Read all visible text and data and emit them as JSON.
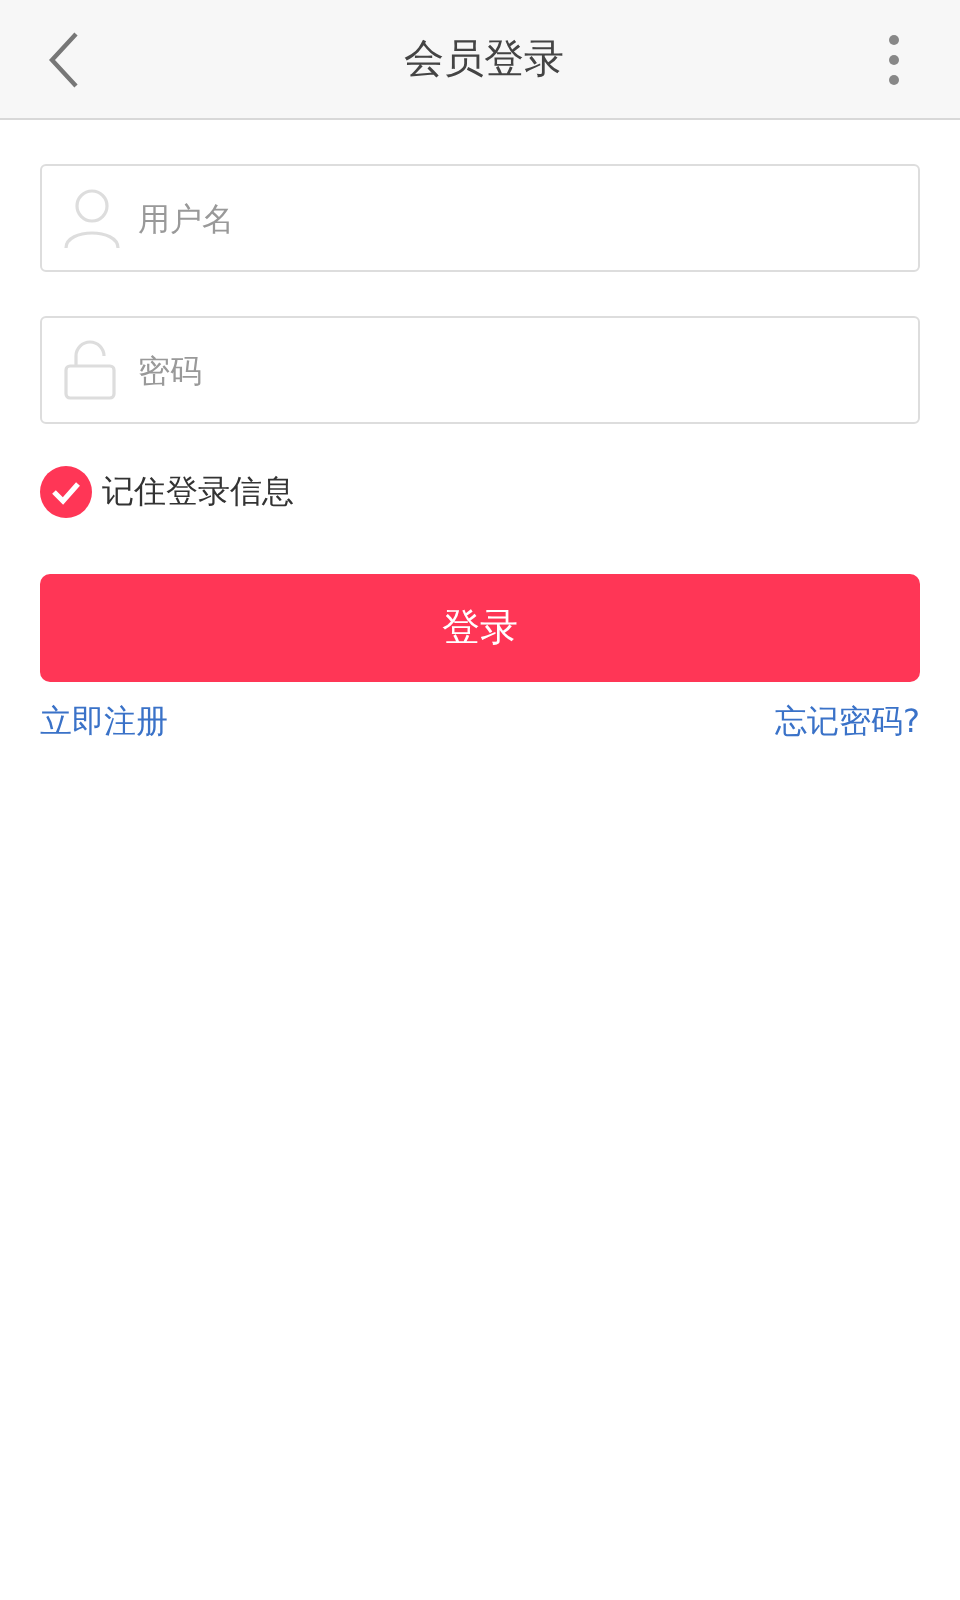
{
  "header": {
    "title": "会员登录"
  },
  "fields": [
    {
      "kind": "user",
      "placeholder": "用户名"
    },
    {
      "kind": "lock",
      "placeholder": "密码"
    }
  ],
  "remember": {
    "label": "记住登录信息",
    "checked": true
  },
  "login_button": "登录",
  "links": {
    "register": "立即注册",
    "forgot": "忘记密码?"
  }
}
